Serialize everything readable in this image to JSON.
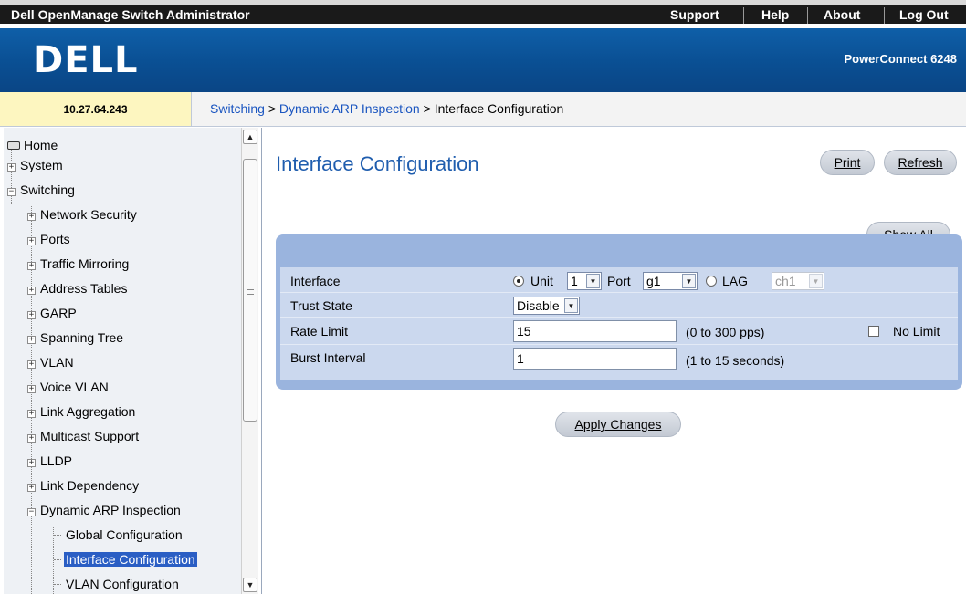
{
  "topbar": {
    "app_title": "Dell OpenManage Switch Administrator",
    "links": [
      "Support",
      "Help",
      "About",
      "Log Out"
    ]
  },
  "header": {
    "logo": "DELL",
    "model": "PowerConnect 6248"
  },
  "address": "10.27.64.243",
  "breadcrumb": {
    "section": "Switching",
    "sub": "Dynamic ARP Inspection",
    "current": "Interface Configuration",
    "sep": ">"
  },
  "sidebar": {
    "items": [
      {
        "label": "Home"
      },
      {
        "label": "System"
      },
      {
        "label": "Switching"
      },
      {
        "label": "Network Security"
      },
      {
        "label": "Ports"
      },
      {
        "label": "Traffic Mirroring"
      },
      {
        "label": "Address Tables"
      },
      {
        "label": "GARP"
      },
      {
        "label": "Spanning Tree"
      },
      {
        "label": "VLAN"
      },
      {
        "label": "Voice VLAN"
      },
      {
        "label": "Link Aggregation"
      },
      {
        "label": "Multicast Support"
      },
      {
        "label": "LLDP"
      },
      {
        "label": "Link Dependency"
      },
      {
        "label": "Dynamic ARP Inspection"
      },
      {
        "label": "Global Configuration"
      },
      {
        "label": "Interface Configuration"
      },
      {
        "label": "VLAN Configuration"
      }
    ],
    "selected": "Interface Configuration"
  },
  "main": {
    "title": "Interface Configuration",
    "print_label": "Print",
    "refresh_label": "Refresh",
    "show_all_label": "Show All",
    "apply_label": "Apply Changes"
  },
  "form": {
    "interface_label": "Interface",
    "unit_label": "Unit",
    "unit_value": "1",
    "port_label": "Port",
    "port_value": "g1",
    "lag_label": "LAG",
    "lag_value": "ch1",
    "interface_mode": "Unit",
    "trust_state_label": "Trust State",
    "trust_state_value": "Disable",
    "rate_limit_label": "Rate Limit",
    "rate_limit_value": "15",
    "rate_limit_hint": "(0 to 300 pps)",
    "no_limit_label": "No Limit",
    "no_limit_checked": false,
    "burst_interval_label": "Burst Interval",
    "burst_interval_value": "1",
    "burst_interval_hint": "(1 to 15 seconds)"
  },
  "colors": {
    "topbar_bg": "#1a1a1a",
    "header_blue": "#0a4f93",
    "title_blue": "#1f5dae",
    "panel_blue": "#9ab4de",
    "selected_bg": "#2a5ec4"
  }
}
